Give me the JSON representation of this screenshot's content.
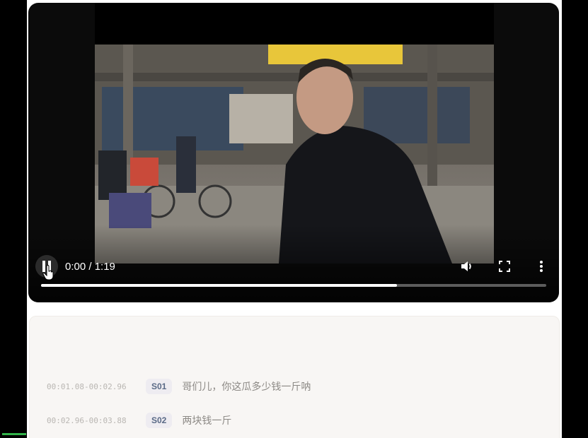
{
  "player": {
    "time_display": "0:00 / 1:19",
    "progress": 0.705
  },
  "transcript": {
    "lines": [
      {
        "timestamp": "00:01.08-00:02.96",
        "speaker": "S01",
        "text": "哥们儿，你这瓜多少钱一斤呐"
      },
      {
        "timestamp": "00:02.96-00:03.88",
        "speaker": "S02",
        "text": "两块钱一斤"
      }
    ]
  },
  "colors": {
    "player_bg": "#0b0b0b",
    "transcript_bg": "#f8f6f4",
    "speaker_badge_text": "#5a6a86",
    "accent_green": "#32b44a"
  },
  "icons": [
    "pause-icon",
    "volume-icon",
    "fullscreen-icon",
    "more-options-icon",
    "hand-cursor-icon"
  ]
}
